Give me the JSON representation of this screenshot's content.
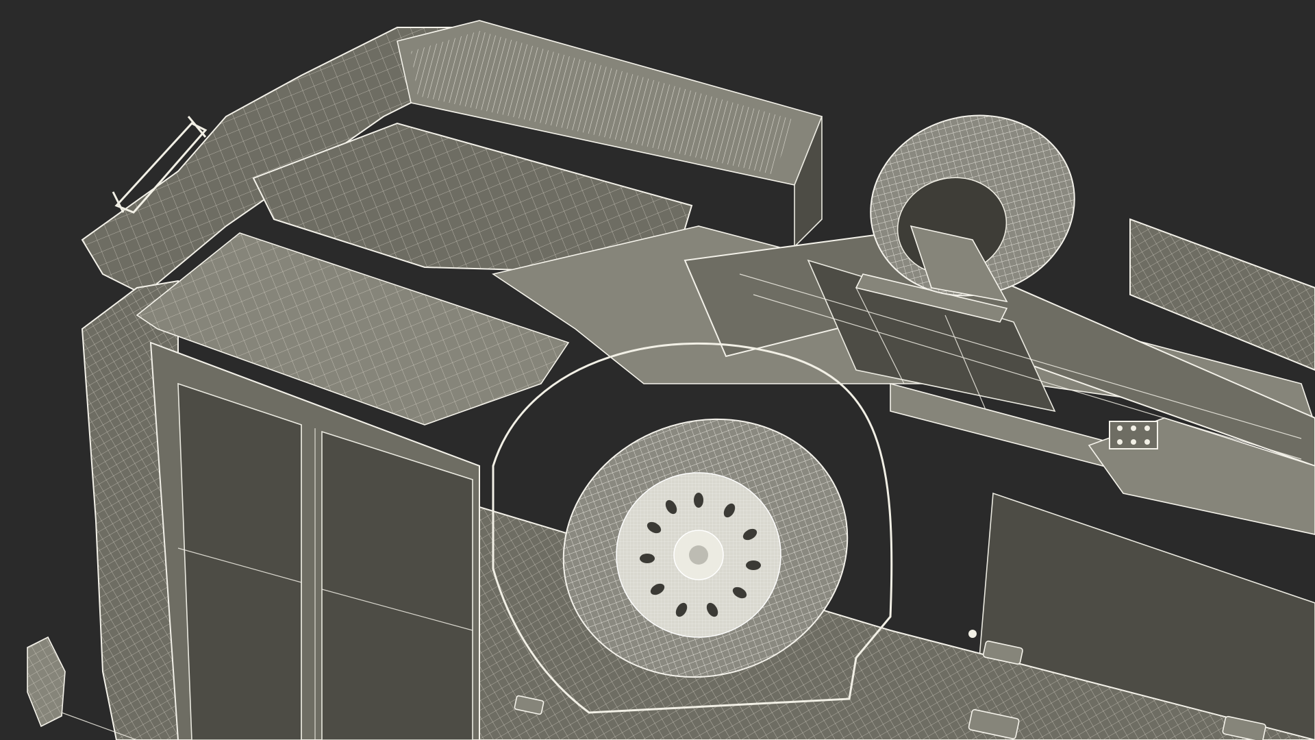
{
  "scene": {
    "subject": "van-underside-wireframe-render",
    "colors": {
      "background": "#2a2a2a",
      "body": "#6e6d63",
      "wire": "#f2f0e6",
      "tire": "#8a8980"
    }
  }
}
